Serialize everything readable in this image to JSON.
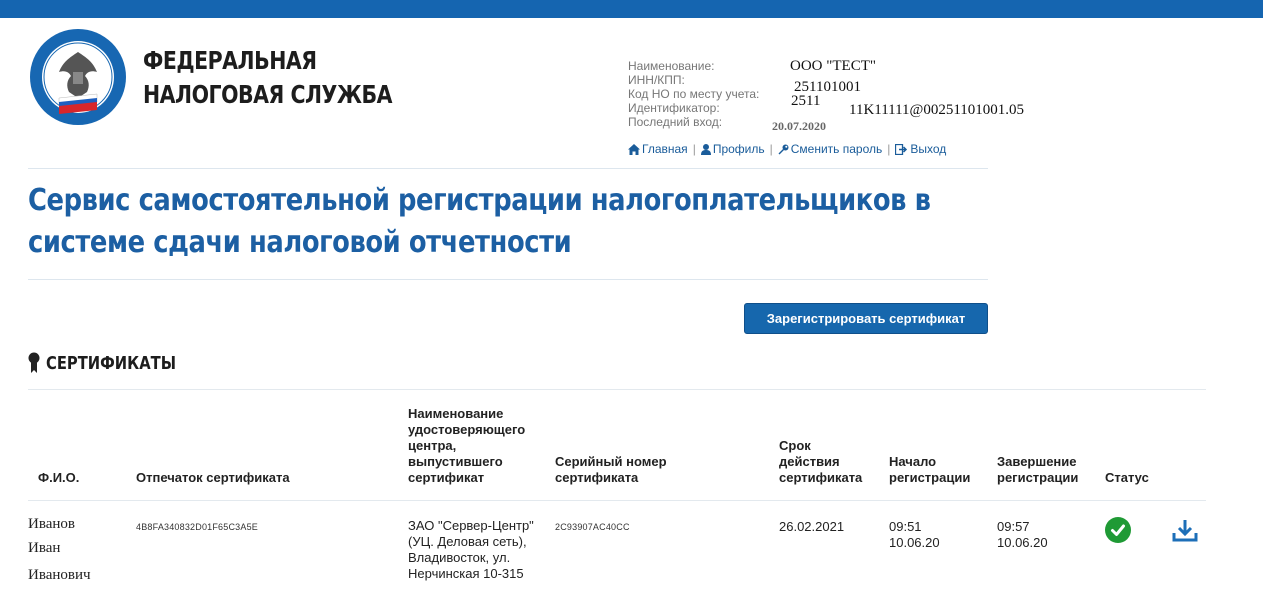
{
  "colors": {
    "brand_blue": "#1565b0",
    "title_blue": "#1c5fa3",
    "link": "#1a5c9a",
    "status_ok": "#1f9a35"
  },
  "header": {
    "agency_line1": "ФЕДЕРАЛЬНАЯ",
    "agency_line2": "НАЛОГОВАЯ СЛУЖБА",
    "logo_icon": "fns-emblem-icon"
  },
  "account": {
    "name_label": "Наименование:",
    "name_value": "ООО \"ТЕСТ\"",
    "inn_label": "ИНН/КПП:",
    "inn_value": "251101001",
    "code_label": "Код НО по месту учета:",
    "code_value": "2511",
    "id_label": "Идентификатор:",
    "id_value": "11K11111@00251101001.05",
    "last_label": "Последний вход:",
    "last_value": "20.07.2020"
  },
  "nav": {
    "home": "Главная",
    "profile": "Профиль",
    "change_password": "Сменить пароль",
    "logout": "Выход"
  },
  "page_title": "Сервис самостоятельной регистрации налогоплательщиков в системе сдачи налоговой отчетности",
  "register_button": "Зарегистрировать сертификат",
  "section_title": "СЕРТИФИКАТЫ",
  "table": {
    "headers": {
      "fio": "Ф.И.О.",
      "thumbprint": "Отпечаток сертификата",
      "ca": "Наименование удостоверяющего центра, выпустившего сертификат",
      "serial": "Серийный номер сертификата",
      "validity": "Срок действия сертификата",
      "start": "Начало регистрации",
      "end": "Завершение регистрации",
      "status": "Статус"
    },
    "rows": [
      {
        "fio_1": "Иванов",
        "fio_2": "Иван",
        "fio_3": "Иванович",
        "thumbprint": "4B8FA340832D01F65C3A5E",
        "ca": "ЗАО \"Сервер-Центр\" (УЦ. Деловая сеть), Владивосток, ул. Нерчинская 10-315",
        "serial": "2C93907AC40CC",
        "validity": "26.02.2021",
        "start_time": "09:51",
        "start_date": "10.06.20",
        "end_time": "09:57",
        "end_date": "10.06.20",
        "status_icon": "check-circle-icon",
        "action_icon": "download-icon"
      }
    ]
  }
}
